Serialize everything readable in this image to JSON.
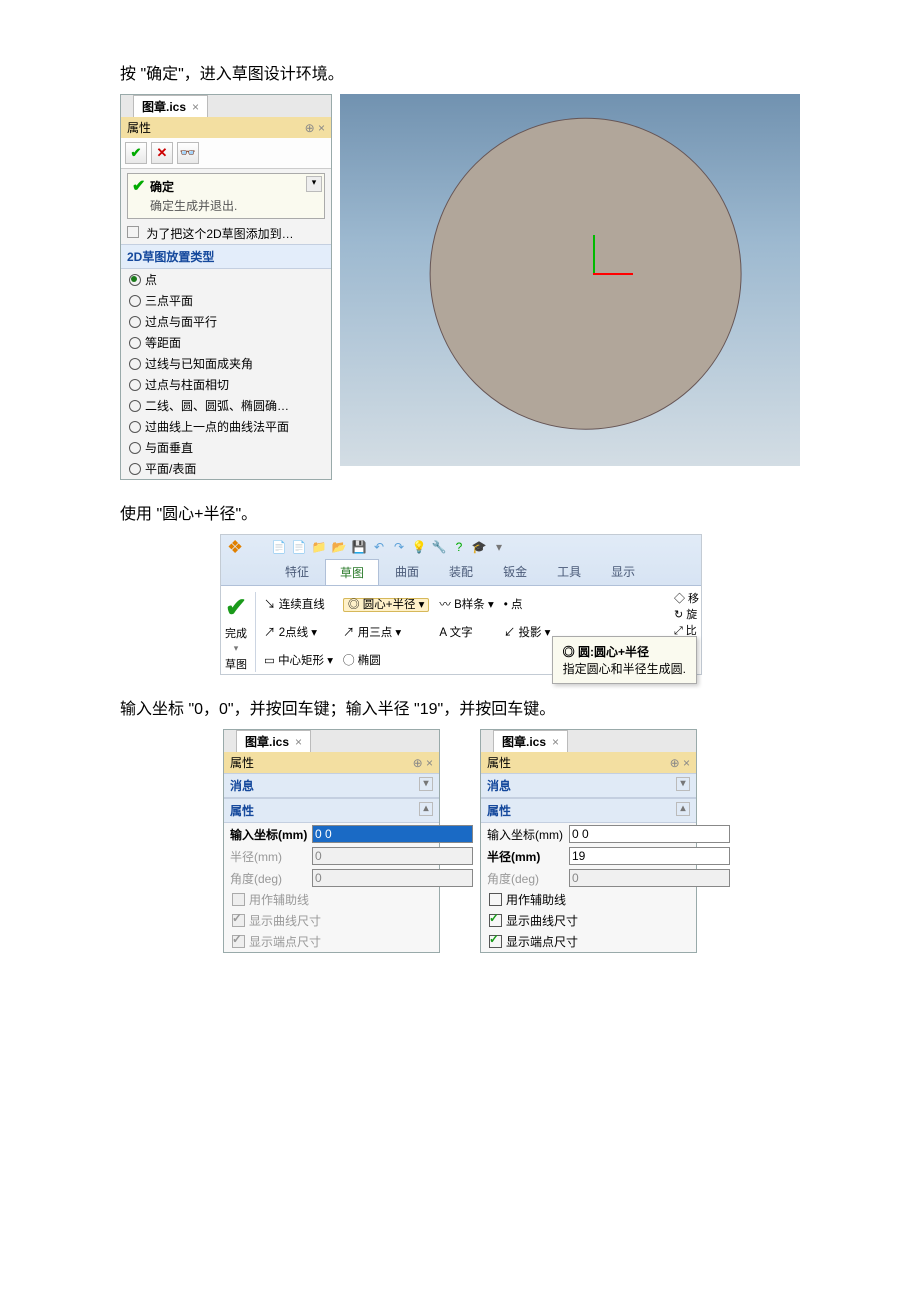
{
  "paragraph1": "按 \"确定\"，进入草图设计环境。",
  "paragraph2": "使用 \"圆心+半径\"。",
  "paragraph3": "输入坐标 \"0，0\"，并按回车键；输入半径 \"19\"，并按回车键。",
  "panel1": {
    "tab_name": "图章.ics",
    "prop_title": "属性",
    "tooltip_title": "确定",
    "tooltip_sub": "确定生成并退出.",
    "sect_line": "为了把这个2D草图添加到…",
    "sect_title": "2D草图放置类型",
    "options": [
      "点",
      "三点平面",
      "过点与面平行",
      "等距面",
      "过线与已知面成夹角",
      "过点与柱面相切",
      "二线、圆、圆弧、椭圆确…",
      "过曲线上一点的曲线法平面",
      "与面垂直",
      "平面/表面"
    ]
  },
  "ribbon": {
    "tabs": [
      "特征",
      "草图",
      "曲面",
      "装配",
      "钣金",
      "工具",
      "显示"
    ],
    "active_tab_index": 1,
    "complete": "完成",
    "sketch": "草图",
    "row1": [
      "连续直线",
      "圆心+半径",
      "B样条",
      "点",
      "移"
    ],
    "row2": [
      "2点线",
      "用三点",
      "文字",
      "投影",
      "旋"
    ],
    "row3": [
      "中心矩形",
      "椭圆",
      "",
      "",
      "比"
    ],
    "tooltip_title": "圆:圆心+半径",
    "tooltip_sub": "指定圆心和半径生成圆."
  },
  "panel3": {
    "tab_name": "图章.ics",
    "prop_title": "属性",
    "msg": "消息",
    "attr": "属性",
    "coord_label": "输入坐标(mm)",
    "coord_value": "0 0",
    "radius_label": "半径(mm)",
    "radius_value": "0",
    "angle_label": "角度(deg)",
    "angle_value": "0",
    "cb1": "用作辅助线",
    "cb2": "显示曲线尺寸",
    "cb3": "显示端点尺寸"
  },
  "panel4": {
    "tab_name": "图章.ics",
    "prop_title": "属性",
    "msg": "消息",
    "attr": "属性",
    "coord_label": "输入坐标(mm)",
    "coord_value": "0 0",
    "radius_label": "半径(mm)",
    "radius_value": "19",
    "angle_label": "角度(deg)",
    "angle_value": "0",
    "cb1": "用作辅助线",
    "cb2": "显示曲线尺寸",
    "cb3": "显示端点尺寸"
  }
}
